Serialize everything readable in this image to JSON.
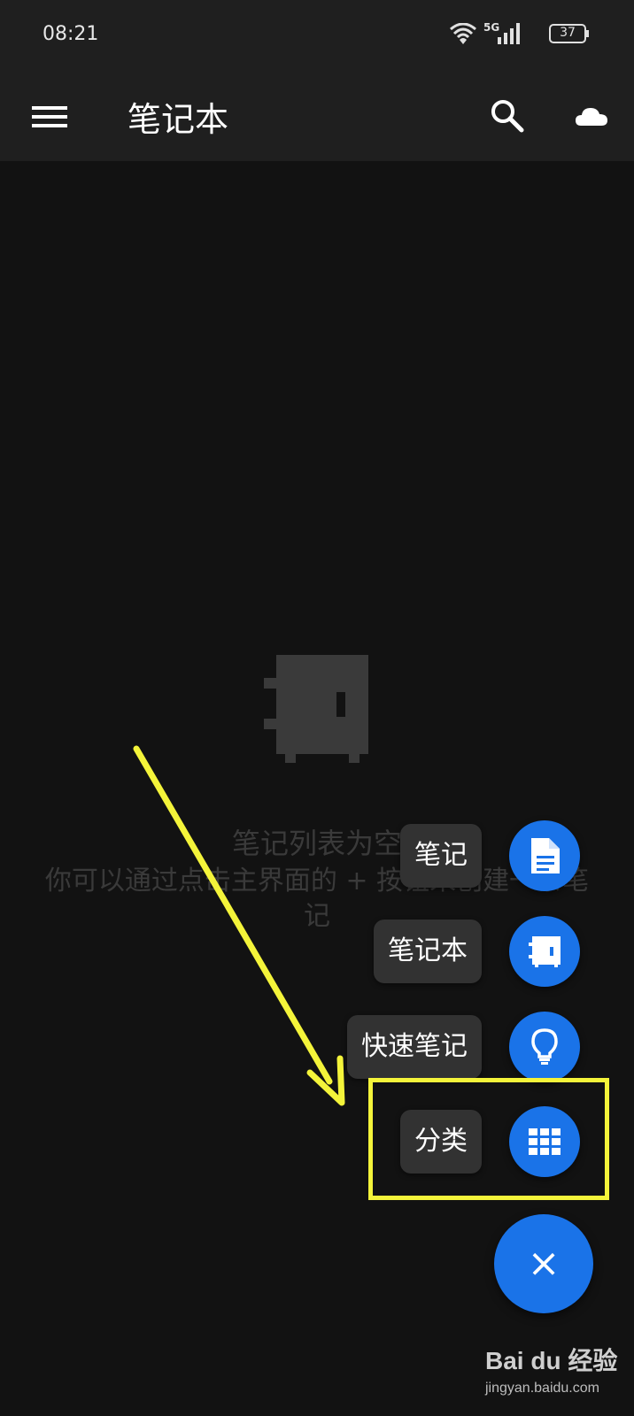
{
  "status_bar": {
    "time": "08:21",
    "network": "5G",
    "battery": "37"
  },
  "app_bar": {
    "title": "笔记本"
  },
  "empty_state": {
    "title": "笔记列表为空",
    "hint": "你可以通过点击主界面的 + 按钮来创建一条笔记"
  },
  "fab_menu": {
    "items": [
      {
        "label": "笔记",
        "icon": "document-icon"
      },
      {
        "label": "笔记本",
        "icon": "notebook-icon"
      },
      {
        "label": "快速笔记",
        "icon": "lightbulb-icon"
      },
      {
        "label": "分类",
        "icon": "grid-icon"
      }
    ],
    "close_symbol": "×"
  },
  "watermark": {
    "logo": "Bai du 经验",
    "url": "jingyan.baidu.com"
  },
  "colors": {
    "accent": "#1a73e8",
    "highlight": "#f4f43a",
    "background": "#121212",
    "bar": "#1f1f1f"
  }
}
